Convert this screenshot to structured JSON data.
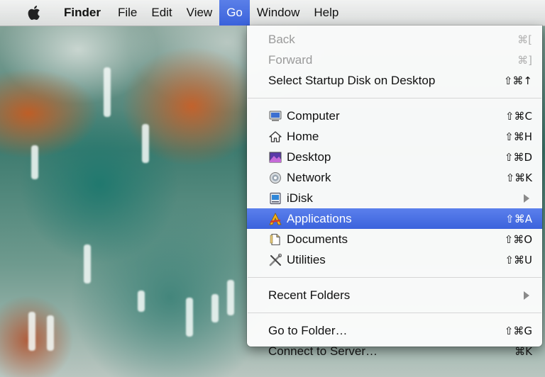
{
  "menubar": {
    "apple_icon": "apple-logo-icon",
    "items": [
      {
        "label": "Finder"
      },
      {
        "label": "File"
      },
      {
        "label": "Edit"
      },
      {
        "label": "View"
      },
      {
        "label": "Go"
      },
      {
        "label": "Window"
      },
      {
        "label": "Help"
      }
    ],
    "active_item": "Go"
  },
  "go_menu": {
    "back": {
      "label": "Back",
      "shortcut": "⌘[",
      "enabled": false
    },
    "forward": {
      "label": "Forward",
      "shortcut": "⌘]",
      "enabled": false
    },
    "startup_disk": {
      "label": "Select Startup Disk on Desktop",
      "shortcut": "⇧⌘↑"
    },
    "computer": {
      "label": "Computer",
      "shortcut": "⇧⌘C",
      "icon": "computer-icon"
    },
    "home": {
      "label": "Home",
      "shortcut": "⇧⌘H",
      "icon": "home-icon"
    },
    "desktop": {
      "label": "Desktop",
      "shortcut": "⇧⌘D",
      "icon": "desktop-icon"
    },
    "network": {
      "label": "Network",
      "shortcut": "⇧⌘K",
      "icon": "network-icon"
    },
    "idisk": {
      "label": "iDisk",
      "icon": "idisk-icon",
      "has_submenu": true
    },
    "applications": {
      "label": "Applications",
      "shortcut": "⇧⌘A",
      "icon": "applications-icon",
      "highlighted": true
    },
    "documents": {
      "label": "Documents",
      "shortcut": "⇧⌘O",
      "icon": "documents-icon"
    },
    "utilities": {
      "label": "Utilities",
      "shortcut": "⇧⌘U",
      "icon": "utilities-icon"
    },
    "recent_folders": {
      "label": "Recent Folders",
      "has_submenu": true
    },
    "go_to_folder": {
      "label": "Go to Folder…",
      "shortcut": "⇧⌘G"
    },
    "connect_server": {
      "label": "Connect to Server…",
      "shortcut": "⌘K"
    }
  },
  "colors": {
    "highlight": "#3b63dc",
    "menubar_bg": "#ececec",
    "disabled_text": "#9a9a9a"
  }
}
